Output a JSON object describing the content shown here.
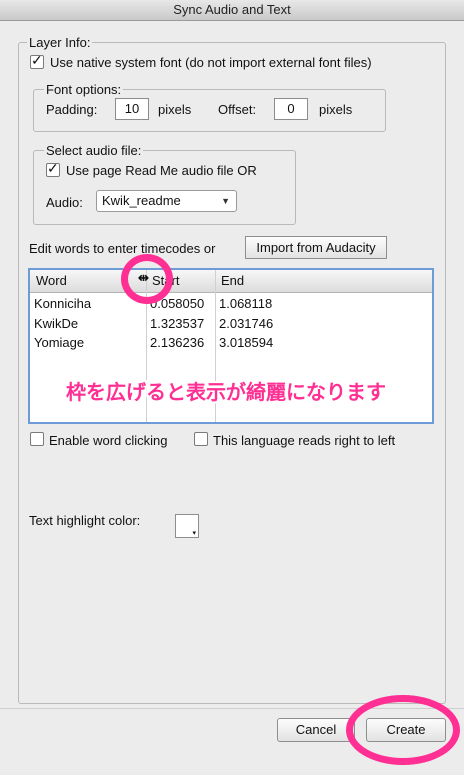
{
  "window": {
    "title": "Sync Audio and Text"
  },
  "layer_info": {
    "label": "Layer Info:",
    "native_font": {
      "label": "Use native system font (do not import external font files)",
      "checked": true
    }
  },
  "font_options": {
    "label": "Font options:",
    "padding_label": "Padding:",
    "padding_value": "10",
    "padding_unit": "pixels",
    "offset_label": "Offset:",
    "offset_value": "0",
    "offset_unit": "pixels"
  },
  "audio_file": {
    "label": "Select audio file:",
    "use_page": {
      "label": "Use page Read Me audio file  OR",
      "checked": true
    },
    "audio_label": "Audio:",
    "audio_value": "Kwik_readme"
  },
  "timecodes": {
    "prompt": "Edit words to enter timecodes or",
    "import_button": "Import from Audacity"
  },
  "table": {
    "columns": [
      "Word",
      "Start",
      "End"
    ],
    "rows": [
      {
        "word": "Konniciha",
        "start": "0.058050",
        "end": "1.068118"
      },
      {
        "word": "KwikDe",
        "start": "1.323537",
        "end": "2.031746"
      },
      {
        "word": "Yomiage",
        "start": "2.136236",
        "end": "3.018594"
      }
    ]
  },
  "annotation": {
    "text": "枠を広げると表示が綺麗になります",
    "color": "#ff2f93"
  },
  "options": {
    "word_clicking": {
      "label": "Enable word clicking",
      "checked": false
    },
    "rtl": {
      "label": "This language reads right to left",
      "checked": false
    }
  },
  "highlight": {
    "label": "Text highlight color:",
    "swatch_color": "#ffffff"
  },
  "buttons": {
    "cancel": "Cancel",
    "create": "Create"
  }
}
